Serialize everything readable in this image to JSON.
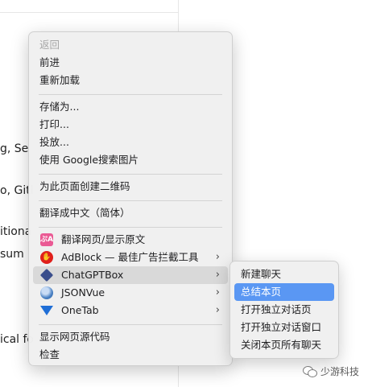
{
  "background": {
    "lines": [
      "g, Se",
      "o, Gitl",
      "itiona",
      "sum",
      "ical fo"
    ]
  },
  "menu": {
    "items": [
      {
        "label": "返回",
        "disabled": true
      },
      {
        "label": "前进"
      },
      {
        "label": "重新加载"
      },
      {
        "label": "存储为..."
      },
      {
        "label": "打印..."
      },
      {
        "label": "投放..."
      },
      {
        "label": "使用 Google搜索图片"
      },
      {
        "label": "为此页面创建二维码"
      },
      {
        "label": "翻译成中文（简体）"
      },
      {
        "label": "翻译网页/显示原文",
        "icon": "translate-icon",
        "icon_glyph": "ぷA"
      },
      {
        "label": "AdBlock — 最佳广告拦截工具",
        "icon": "adblock-hand-icon",
        "icon_glyph": "✋",
        "submenu_arrow": "›"
      },
      {
        "label": "ChatGPTBox",
        "icon": "chatgptbox-icon",
        "submenu_arrow": "›"
      },
      {
        "label": "JSONVue",
        "icon": "jsonvue-icon",
        "submenu_arrow": "›"
      },
      {
        "label": "OneTab",
        "icon": "onetab-icon",
        "submenu_arrow": "›"
      },
      {
        "label": "显示网页源代码"
      },
      {
        "label": "检查"
      }
    ]
  },
  "submenu": {
    "parent": "ChatGPTBox",
    "items": [
      {
        "label": "新建聊天"
      },
      {
        "label": "总结本页",
        "selected": true
      },
      {
        "label": "打开独立对话页"
      },
      {
        "label": "打开独立对话窗口"
      },
      {
        "label": "关闭本页所有聊天"
      }
    ]
  },
  "watermark": {
    "text": "少游科技",
    "icon": "wechat-icon"
  },
  "colors": {
    "menu_bg": "#f0f0f0",
    "selection": "#5a97f3",
    "hover": "#d9d9d9",
    "disabled_text": "#a7a7a7"
  }
}
